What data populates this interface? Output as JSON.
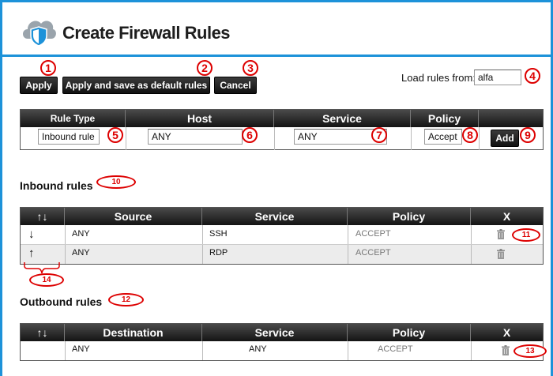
{
  "header": {
    "title": "Create Firewall Rules",
    "logo_icon": "cloud-shield-icon"
  },
  "toolbar": {
    "apply_label": "Apply",
    "apply_default_label": "Apply and save as default rules",
    "cancel_label": "Cancel",
    "load_rules_label": "Load rules from:",
    "load_rules_value": "alfa"
  },
  "new_rule": {
    "headers": [
      "Rule Type",
      "Host",
      "Service",
      "Policy"
    ],
    "rule_type": "Inbound rule",
    "host": "ANY",
    "service": "ANY",
    "policy": "Accept",
    "add_label": "Add"
  },
  "inbound": {
    "title": "Inbound rules",
    "headers": [
      "↑↓",
      "Source",
      "Service",
      "Policy",
      "X"
    ],
    "rows": [
      {
        "source": "ANY",
        "service": "SSH",
        "policy": "ACCEPT"
      },
      {
        "source": "ANY",
        "service": "RDP",
        "policy": "ACCEPT"
      }
    ]
  },
  "outbound": {
    "title": "Outbound rules",
    "headers": [
      "↑↓",
      "Destination",
      "Service",
      "Policy",
      "X"
    ],
    "rows": [
      {
        "destination": "ANY",
        "service": "ANY",
        "policy": "ACCEPT"
      }
    ]
  },
  "callouts": [
    "1",
    "2",
    "3",
    "4",
    "5",
    "6",
    "7",
    "8",
    "9",
    "10",
    "11",
    "12",
    "13",
    "14"
  ],
  "colors": {
    "accent": "#1d92d9",
    "callout": "#dd0000",
    "header_dark": "#141414"
  }
}
